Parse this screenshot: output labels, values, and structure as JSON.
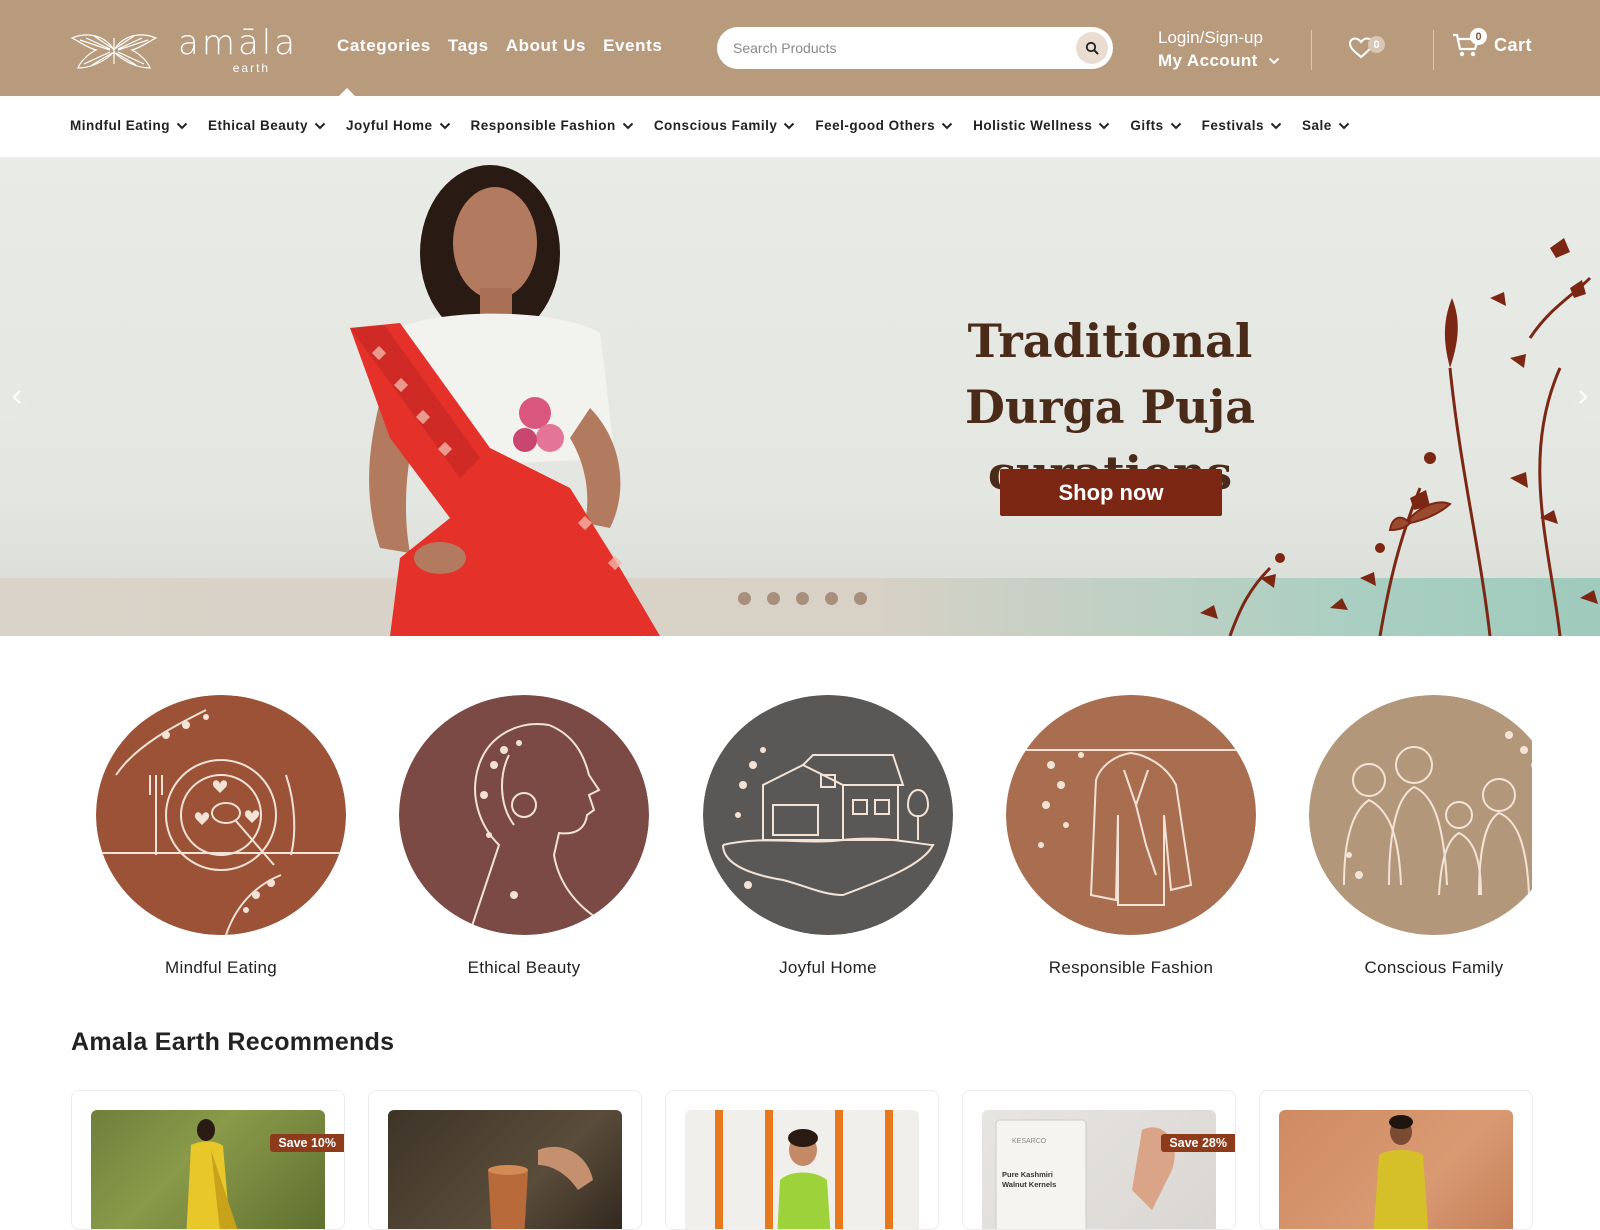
{
  "brand": {
    "name": "amāla",
    "sub": "earth"
  },
  "main_nav": [
    "Categories",
    "Tags",
    "About Us",
    "Events"
  ],
  "search": {
    "placeholder": "Search Products"
  },
  "account": {
    "login_label": "Login/Sign-up",
    "account_label": "My Account"
  },
  "wishlist": {
    "count": "0"
  },
  "cart": {
    "count": "0",
    "label": "Cart"
  },
  "category_nav": [
    "Mindful Eating",
    "Ethical Beauty",
    "Joyful Home",
    "Responsible Fashion",
    "Conscious Family",
    "Feel-good Others",
    "Holistic Wellness",
    "Gifts",
    "Festivals",
    "Sale"
  ],
  "hero": {
    "title_line1": "Traditional",
    "title_line2": "Durga Puja curations",
    "cta": "Shop now",
    "slide_count": 5
  },
  "categories": [
    {
      "label": "Mindful Eating",
      "icon": "plate-cutlery-icon",
      "color": "#9b5236"
    },
    {
      "label": "Ethical Beauty",
      "icon": "woman-profile-icon",
      "color": "#7c4a45"
    },
    {
      "label": "Joyful Home",
      "icon": "house-icon",
      "color": "#5a5857"
    },
    {
      "label": "Responsible Fashion",
      "icon": "jacket-icon",
      "color": "#a86e4f"
    },
    {
      "label": "Conscious Family",
      "icon": "family-icon",
      "color": "#b3977b"
    }
  ],
  "recommends": {
    "title": "Amala Earth Recommends",
    "cards": [
      {
        "badge": "Save 10%",
        "image": "woman-in-yellow-saree"
      },
      {
        "badge": "",
        "image": "copper-glass"
      },
      {
        "badge": "",
        "image": "boy-with-marigold-garlands"
      },
      {
        "badge": "Save 28%",
        "image": "kashmiri-walnut-kernels-pack",
        "pack_brand": "KESARCO",
        "pack_text": "Pure Kashmiri Walnut Kernels"
      },
      {
        "badge": "",
        "image": "man-in-yellow-kurta"
      }
    ]
  },
  "colors": {
    "header_bg": "#b89a7c",
    "cta_bg": "#7b2714",
    "badge_bg": "#8d3b1a",
    "hero_text": "#4a2a18"
  }
}
